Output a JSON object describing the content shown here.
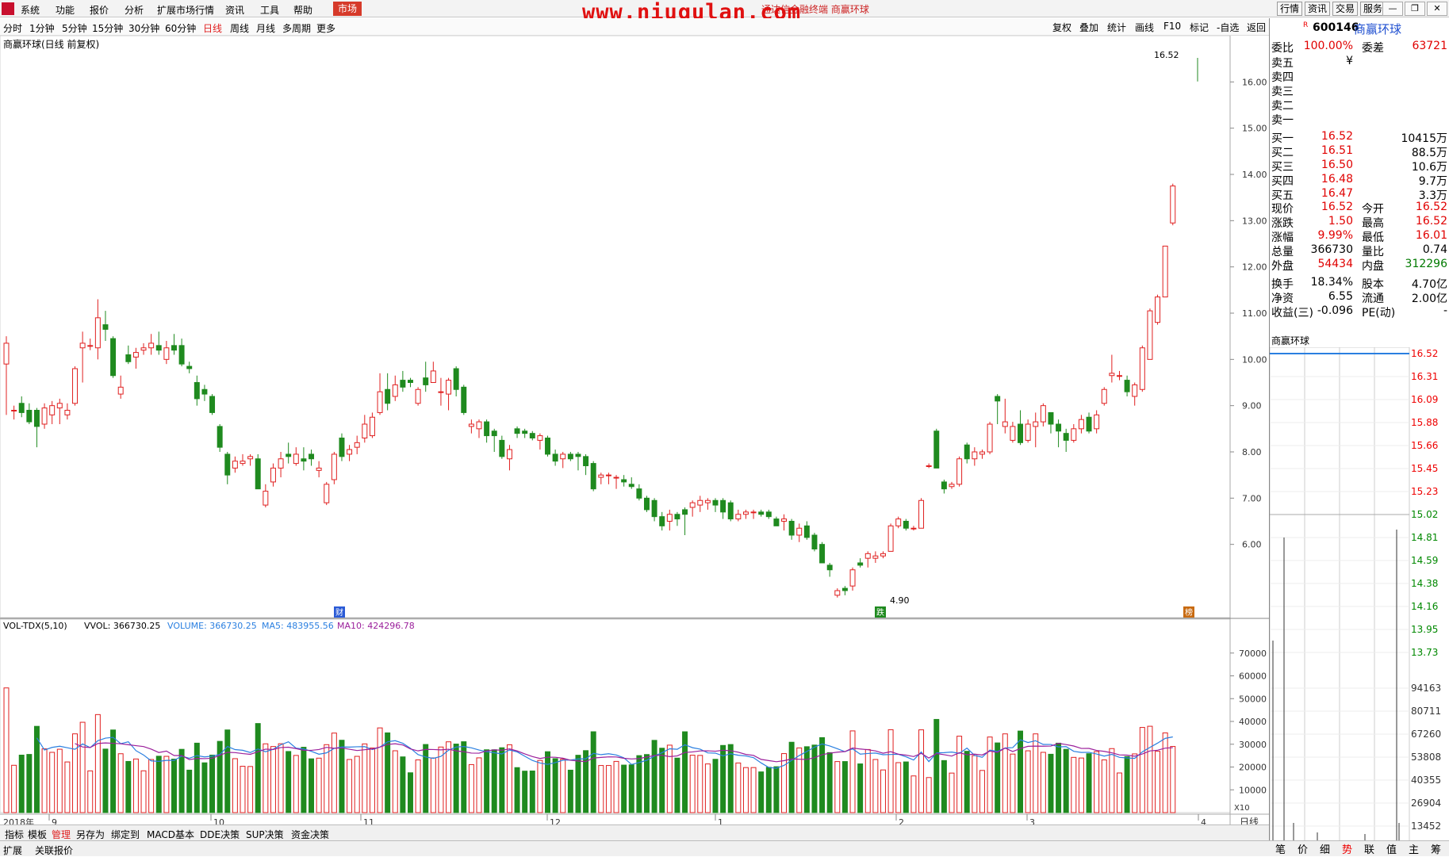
{
  "menu": {
    "items": [
      "系统",
      "功能",
      "报价",
      "分析",
      "扩展市场行情",
      "资讯",
      "工具",
      "帮助"
    ],
    "active": "市场"
  },
  "watermark": "www.niugulan.com",
  "context_title": "通达信金融终端 商赢环球",
  "right_nav": [
    "行情",
    "资讯",
    "交易",
    "服务"
  ],
  "periods": [
    "分时",
    "1分钟",
    "5分钟",
    "15分钟",
    "30分钟",
    "60分钟",
    "日线",
    "周线",
    "月线",
    "多周期",
    "更多"
  ],
  "active_period": "日线",
  "chart_toolbar": [
    "复权",
    "叠加",
    "统计",
    "画线",
    "F10",
    "标记",
    "-自选",
    "返回"
  ],
  "chart_label": "商赢环球(日线 前复权)",
  "high_label": "16.52",
  "low_label": "4.90",
  "price_axis": [
    "16.00",
    "15.00",
    "14.00",
    "13.00",
    "12.00",
    "11.00",
    "10.00",
    "9.00",
    "8.00",
    "7.00",
    "6.00"
  ],
  "vol_header": {
    "name": "VOL-TDX(5,10)",
    "vvol": "VVOL: 366730.25",
    "volume": "VOLUME: 366730.25",
    "ma5": "MA5: 483955.56",
    "ma10": "MA10: 424296.78"
  },
  "vol_axis": [
    "70000",
    "60000",
    "50000",
    "40000",
    "30000",
    "20000",
    "10000"
  ],
  "vol_unit": "X10",
  "date_axis": {
    "year": "2018年",
    "labels": [
      "9",
      "10",
      "11",
      "12",
      "1",
      "2",
      "3",
      "4"
    ],
    "unit": "日线"
  },
  "markers": [
    "财",
    "跌",
    "榜"
  ],
  "quote": {
    "code": "600146",
    "name": "商赢环球",
    "flag": "R",
    "header": [
      {
        "label": "委比",
        "value": "100.00%",
        "label2": "委差",
        "value2": "63721"
      }
    ],
    "sells": [
      {
        "label": "卖五",
        "value": "¥"
      },
      {
        "label": "卖四",
        "value": ""
      },
      {
        "label": "卖三",
        "value": ""
      },
      {
        "label": "卖二",
        "value": ""
      },
      {
        "label": "卖一",
        "value": ""
      }
    ],
    "buys": [
      {
        "label": "买一",
        "price": "16.52",
        "vol": "10415万"
      },
      {
        "label": "买二",
        "price": "16.51",
        "vol": "88.5万"
      },
      {
        "label": "买三",
        "price": "16.50",
        "vol": "10.6万"
      },
      {
        "label": "买四",
        "price": "16.48",
        "vol": "9.7万"
      },
      {
        "label": "买五",
        "price": "16.47",
        "vol": "3.3万"
      }
    ],
    "stats": [
      {
        "l1": "现价",
        "v1": "16.52",
        "l2": "今开",
        "v2": "16.52"
      },
      {
        "l1": "涨跌",
        "v1": "1.50",
        "l2": "最高",
        "v2": "16.52"
      },
      {
        "l1": "涨幅",
        "v1": "9.99%",
        "l2": "最低",
        "v2": "16.01"
      },
      {
        "l1": "总量",
        "v1": "366730",
        "l2": "量比",
        "v2": "0.74"
      },
      {
        "l1": "外盘",
        "v1": "54434",
        "l2": "内盘",
        "v2": "312296"
      }
    ],
    "stats2": [
      {
        "l1": "换手",
        "v1": "18.34%",
        "l2": "股本",
        "v2": "4.70亿"
      },
      {
        "l1": "净资",
        "v1": "6.55",
        "l2": "流通",
        "v2": "2.00亿"
      },
      {
        "l1": "收益(三)",
        "v1": "-0.096",
        "l2": "PE(动)",
        "v2": "-"
      }
    ]
  },
  "mini_title": "商赢环球",
  "mini_price_axis": [
    "16.52",
    "16.31",
    "16.09",
    "15.88",
    "15.66",
    "15.45",
    "15.23",
    "15.02",
    "14.81",
    "14.59",
    "14.38",
    "14.16",
    "13.95",
    "13.73"
  ],
  "mini_vol_axis": [
    "94163",
    "80711",
    "67260",
    "53808",
    "40355",
    "26904",
    "13452"
  ],
  "bottom_tabs1": [
    "指标",
    "模板",
    "管理",
    "另存为",
    "绑定到",
    "MACD基本",
    "DDE决策",
    "SUP决策",
    "资金决策"
  ],
  "bottom_tabs2": [
    "扩展",
    "关联报价"
  ],
  "side_tabs": [
    "笔",
    "价",
    "细",
    "势",
    "联",
    "值",
    "主",
    "筹"
  ],
  "colors": {
    "up": "#e02020",
    "down": "#1f8a1f",
    "ma5": "#2a7fe0",
    "ma10": "#9b1f9b",
    "accent": "#d63a2a"
  },
  "chart_data": {
    "type": "candlestick",
    "y_range": [
      4.4,
      17.0
    ],
    "candles": [
      [
        9.9,
        10.35,
        8.8,
        10.5
      ],
      [
        8.9,
        8.9,
        8.7,
        9.0
      ],
      [
        9.05,
        8.85,
        8.75,
        9.2
      ],
      [
        8.9,
        8.65,
        8.6,
        9.05
      ],
      [
        8.9,
        8.55,
        8.1,
        8.95
      ],
      [
        8.6,
        8.95,
        8.5,
        9.05
      ],
      [
        8.8,
        9.0,
        8.6,
        9.1
      ],
      [
        8.95,
        9.05,
        8.6,
        9.15
      ],
      [
        8.8,
        8.9,
        8.7,
        9.05
      ],
      [
        9.05,
        9.8,
        9.0,
        9.85
      ],
      [
        10.25,
        10.35,
        9.5,
        10.6
      ],
      [
        10.3,
        10.3,
        10.2,
        10.45
      ],
      [
        10.25,
        10.9,
        10.0,
        11.3
      ],
      [
        10.75,
        10.65,
        10.4,
        11.05
      ],
      [
        10.45,
        9.65,
        9.6,
        10.5
      ],
      [
        9.25,
        9.4,
        9.15,
        9.65
      ],
      [
        10.1,
        9.95,
        9.9,
        10.3
      ],
      [
        10.05,
        10.15,
        9.8,
        10.25
      ],
      [
        10.2,
        10.25,
        10.1,
        10.35
      ],
      [
        10.25,
        10.35,
        10.1,
        10.55
      ],
      [
        10.3,
        10.2,
        10.1,
        10.6
      ],
      [
        10.0,
        10.25,
        9.9,
        10.4
      ],
      [
        10.3,
        10.2,
        10.1,
        10.55
      ],
      [
        10.3,
        9.9,
        9.85,
        10.45
      ],
      [
        9.85,
        9.8,
        9.7,
        9.95
      ],
      [
        9.5,
        9.15,
        9.0,
        9.65
      ],
      [
        9.35,
        9.25,
        9.1,
        9.45
      ],
      [
        9.2,
        8.85,
        8.8,
        9.25
      ],
      [
        8.55,
        8.1,
        8.0,
        8.6
      ],
      [
        7.95,
        7.5,
        7.3,
        8.0
      ],
      [
        7.65,
        7.8,
        7.55,
        7.9
      ],
      [
        7.75,
        7.8,
        7.7,
        7.95
      ],
      [
        7.85,
        7.9,
        7.7,
        7.95
      ],
      [
        7.85,
        7.2,
        7.2,
        7.95
      ],
      [
        6.85,
        7.15,
        6.8,
        7.3
      ],
      [
        7.35,
        7.65,
        7.25,
        7.75
      ],
      [
        7.65,
        7.85,
        7.45,
        8.0
      ],
      [
        7.95,
        7.9,
        7.75,
        8.2
      ],
      [
        7.75,
        7.95,
        7.7,
        8.1
      ],
      [
        7.85,
        7.8,
        7.6,
        8.1
      ],
      [
        7.95,
        7.85,
        7.7,
        8.05
      ],
      [
        7.6,
        7.65,
        7.45,
        7.8
      ],
      [
        6.9,
        7.3,
        6.85,
        7.35
      ],
      [
        7.4,
        7.95,
        7.3,
        8.0
      ],
      [
        8.3,
        7.9,
        7.8,
        8.4
      ],
      [
        7.95,
        8.05,
        7.8,
        8.15
      ],
      [
        8.1,
        8.2,
        7.95,
        8.35
      ],
      [
        8.3,
        8.6,
        8.2,
        8.8
      ],
      [
        8.35,
        8.75,
        8.3,
        8.85
      ],
      [
        8.85,
        9.3,
        8.8,
        9.7
      ],
      [
        9.35,
        9.05,
        8.9,
        9.7
      ],
      [
        9.2,
        9.45,
        9.1,
        9.65
      ],
      [
        9.55,
        9.4,
        9.3,
        9.75
      ],
      [
        9.55,
        9.5,
        9.4,
        9.6
      ],
      [
        9.05,
        9.35,
        9.0,
        9.4
      ],
      [
        9.6,
        9.45,
        9.3,
        9.95
      ],
      [
        9.5,
        9.75,
        9.5,
        9.95
      ],
      [
        9.3,
        9.3,
        9.0,
        9.6
      ],
      [
        9.25,
        9.55,
        8.9,
        9.6
      ],
      [
        9.8,
        9.35,
        9.2,
        9.85
      ],
      [
        9.4,
        8.85,
        8.8,
        9.45
      ],
      [
        8.55,
        8.6,
        8.4,
        8.7
      ],
      [
        8.5,
        8.65,
        8.3,
        8.7
      ],
      [
        8.65,
        8.35,
        8.2,
        8.7
      ],
      [
        8.45,
        8.35,
        8.0,
        8.5
      ],
      [
        8.25,
        7.9,
        7.85,
        8.35
      ],
      [
        7.85,
        8.05,
        7.6,
        8.15
      ],
      [
        8.5,
        8.4,
        8.3,
        8.55
      ],
      [
        8.45,
        8.4,
        8.3,
        8.5
      ],
      [
        8.4,
        8.3,
        8.25,
        8.45
      ],
      [
        8.25,
        8.35,
        8.05,
        8.4
      ],
      [
        8.3,
        7.95,
        7.9,
        8.35
      ],
      [
        7.95,
        7.8,
        7.7,
        8.05
      ],
      [
        7.85,
        7.95,
        7.65,
        8.0
      ],
      [
        7.95,
        7.85,
        7.8,
        8.0
      ],
      [
        7.95,
        7.9,
        7.6,
        8.0
      ],
      [
        7.9,
        7.7,
        7.5,
        7.95
      ],
      [
        7.75,
        7.2,
        7.15,
        7.8
      ],
      [
        7.45,
        7.5,
        7.3,
        7.55
      ],
      [
        7.5,
        7.5,
        7.3,
        7.55
      ],
      [
        7.45,
        7.45,
        7.2,
        7.5
      ],
      [
        7.4,
        7.35,
        7.25,
        7.5
      ],
      [
        7.3,
        7.25,
        7.2,
        7.45
      ],
      [
        7.2,
        7.0,
        6.95,
        7.3
      ],
      [
        7.0,
        6.75,
        6.7,
        7.05
      ],
      [
        6.95,
        6.6,
        6.5,
        7.0
      ],
      [
        6.6,
        6.4,
        6.3,
        6.7
      ],
      [
        6.5,
        6.65,
        6.3,
        6.75
      ],
      [
        6.65,
        6.55,
        6.4,
        6.7
      ],
      [
        6.75,
        6.65,
        6.2,
        6.8
      ],
      [
        6.8,
        6.9,
        6.6,
        6.95
      ],
      [
        6.85,
        6.95,
        6.7,
        7.05
      ],
      [
        6.9,
        6.95,
        6.75,
        7.0
      ],
      [
        6.95,
        6.85,
        6.7,
        7.0
      ],
      [
        6.95,
        6.7,
        6.55,
        7.0
      ],
      [
        6.9,
        6.55,
        6.5,
        6.95
      ],
      [
        6.55,
        6.65,
        6.5,
        6.75
      ],
      [
        6.65,
        6.7,
        6.55,
        6.75
      ],
      [
        6.7,
        6.7,
        6.55,
        6.75
      ],
      [
        6.7,
        6.65,
        6.6,
        6.75
      ],
      [
        6.7,
        6.6,
        6.55,
        6.75
      ],
      [
        6.55,
        6.4,
        6.4,
        6.6
      ],
      [
        6.5,
        6.55,
        6.3,
        6.65
      ],
      [
        6.5,
        6.2,
        6.1,
        6.55
      ],
      [
        6.2,
        6.35,
        6.05,
        6.45
      ],
      [
        6.4,
        6.15,
        6.1,
        6.5
      ],
      [
        6.2,
        5.9,
        5.85,
        6.25
      ],
      [
        6.0,
        5.6,
        5.6,
        6.05
      ],
      [
        5.55,
        5.45,
        5.3,
        5.6
      ],
      [
        4.9,
        5.0,
        4.85,
        5.05
      ],
      [
        5.05,
        5.0,
        4.9,
        5.1
      ],
      [
        5.1,
        5.45,
        5.0,
        5.5
      ],
      [
        5.6,
        5.55,
        5.5,
        5.7
      ],
      [
        5.7,
        5.8,
        5.5,
        5.85
      ],
      [
        5.7,
        5.75,
        5.6,
        5.85
      ],
      [
        5.75,
        5.8,
        5.7,
        5.85
      ],
      [
        5.85,
        6.4,
        5.85,
        6.45
      ],
      [
        6.4,
        6.55,
        6.35,
        6.6
      ],
      [
        6.5,
        6.35,
        6.3,
        6.55
      ],
      [
        6.35,
        6.35,
        6.3,
        6.4
      ],
      [
        6.35,
        6.95,
        6.35,
        7.0
      ],
      [
        7.7,
        7.7,
        7.65,
        7.75
      ],
      [
        8.45,
        7.65,
        7.65,
        8.5
      ],
      [
        7.35,
        7.2,
        7.1,
        7.4
      ],
      [
        7.25,
        7.3,
        7.2,
        7.35
      ],
      [
        7.3,
        7.85,
        7.25,
        7.9
      ],
      [
        8.15,
        7.85,
        7.75,
        8.2
      ],
      [
        7.85,
        8.0,
        7.7,
        8.1
      ],
      [
        7.95,
        8.0,
        7.85,
        8.05
      ],
      [
        8.0,
        8.6,
        7.95,
        8.65
      ],
      [
        9.2,
        9.1,
        8.6,
        9.25
      ],
      [
        8.55,
        8.65,
        8.4,
        9.15
      ],
      [
        8.25,
        8.55,
        8.2,
        8.65
      ],
      [
        8.6,
        8.2,
        8.15,
        8.9
      ],
      [
        8.25,
        8.6,
        8.2,
        8.7
      ],
      [
        8.55,
        8.65,
        8.1,
        8.85
      ],
      [
        8.65,
        9.0,
        8.55,
        9.05
      ],
      [
        8.85,
        8.6,
        8.4,
        8.85
      ],
      [
        8.6,
        8.45,
        8.1,
        8.7
      ],
      [
        8.4,
        8.25,
        8.0,
        8.5
      ],
      [
        8.25,
        8.5,
        8.2,
        8.6
      ],
      [
        8.5,
        8.7,
        8.4,
        8.8
      ],
      [
        8.75,
        8.45,
        8.4,
        8.85
      ],
      [
        8.5,
        8.8,
        8.4,
        8.9
      ],
      [
        9.05,
        9.35,
        9.0,
        9.4
      ],
      [
        9.65,
        9.7,
        9.5,
        10.1
      ],
      [
        9.65,
        9.65,
        9.55,
        9.75
      ],
      [
        9.55,
        9.3,
        9.2,
        9.65
      ],
      [
        9.2,
        9.45,
        9.0,
        9.5
      ],
      [
        9.35,
        10.25,
        9.3,
        10.3
      ],
      [
        10.0,
        11.05,
        10.0,
        11.1
      ],
      [
        10.8,
        11.35,
        10.75,
        11.4
      ],
      [
        11.35,
        12.45,
        11.35,
        12.45
      ],
      [
        12.95,
        13.75,
        12.9,
        13.8
      ],
      [
        null,
        null,
        null,
        null
      ]
    ]
  }
}
